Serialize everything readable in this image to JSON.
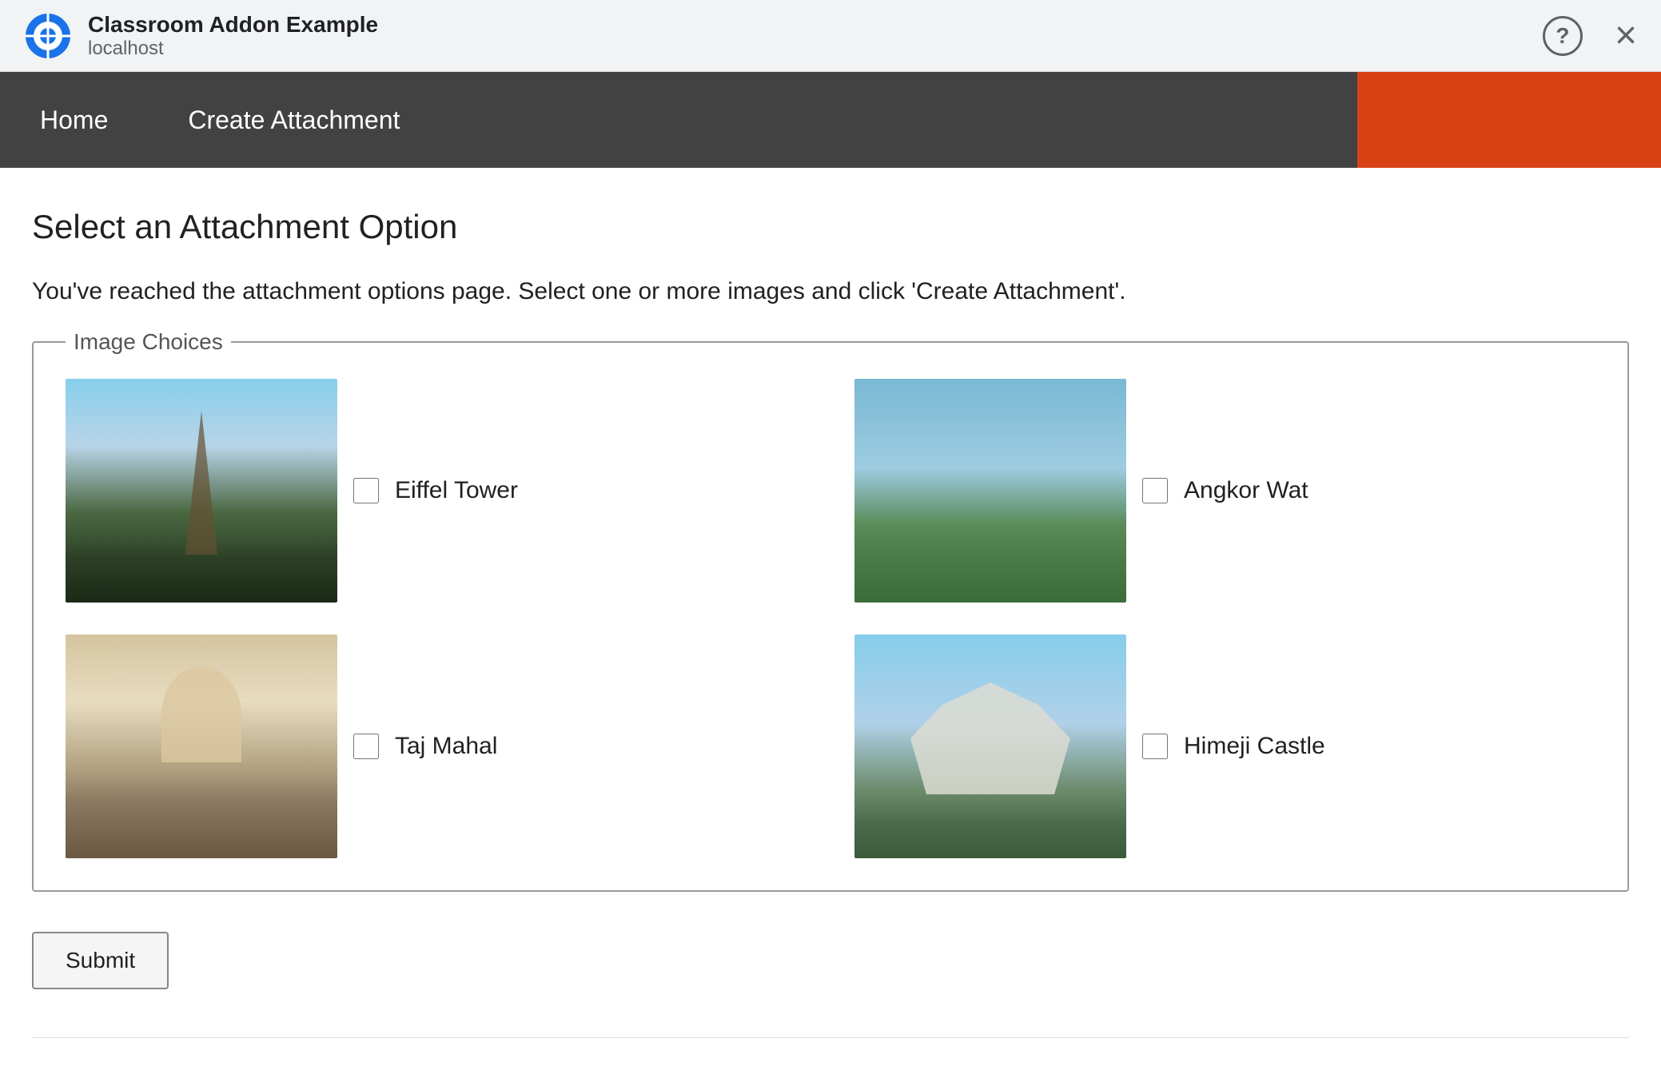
{
  "browser": {
    "app_title": "Classroom Addon Example",
    "url": "localhost",
    "help_label": "?",
    "close_label": "×"
  },
  "navbar": {
    "home_label": "Home",
    "create_attachment_label": "Create Attachment"
  },
  "page": {
    "title": "Select an Attachment Option",
    "description": "You've reached the attachment options page. Select one or more images and click 'Create Attachment'.",
    "fieldset_legend": "Image Choices",
    "images": [
      {
        "id": "eiffel",
        "label": "Eiffel Tower",
        "checked": false
      },
      {
        "id": "angkor",
        "label": "Angkor Wat",
        "checked": false
      },
      {
        "id": "taj",
        "label": "Taj Mahal",
        "checked": false
      },
      {
        "id": "himeji",
        "label": "Himeji Castle",
        "checked": false
      }
    ],
    "submit_label": "Submit"
  },
  "colors": {
    "navbar_bg": "#424242",
    "accent_bg": "#d84315",
    "nav_text": "#ffffff"
  }
}
